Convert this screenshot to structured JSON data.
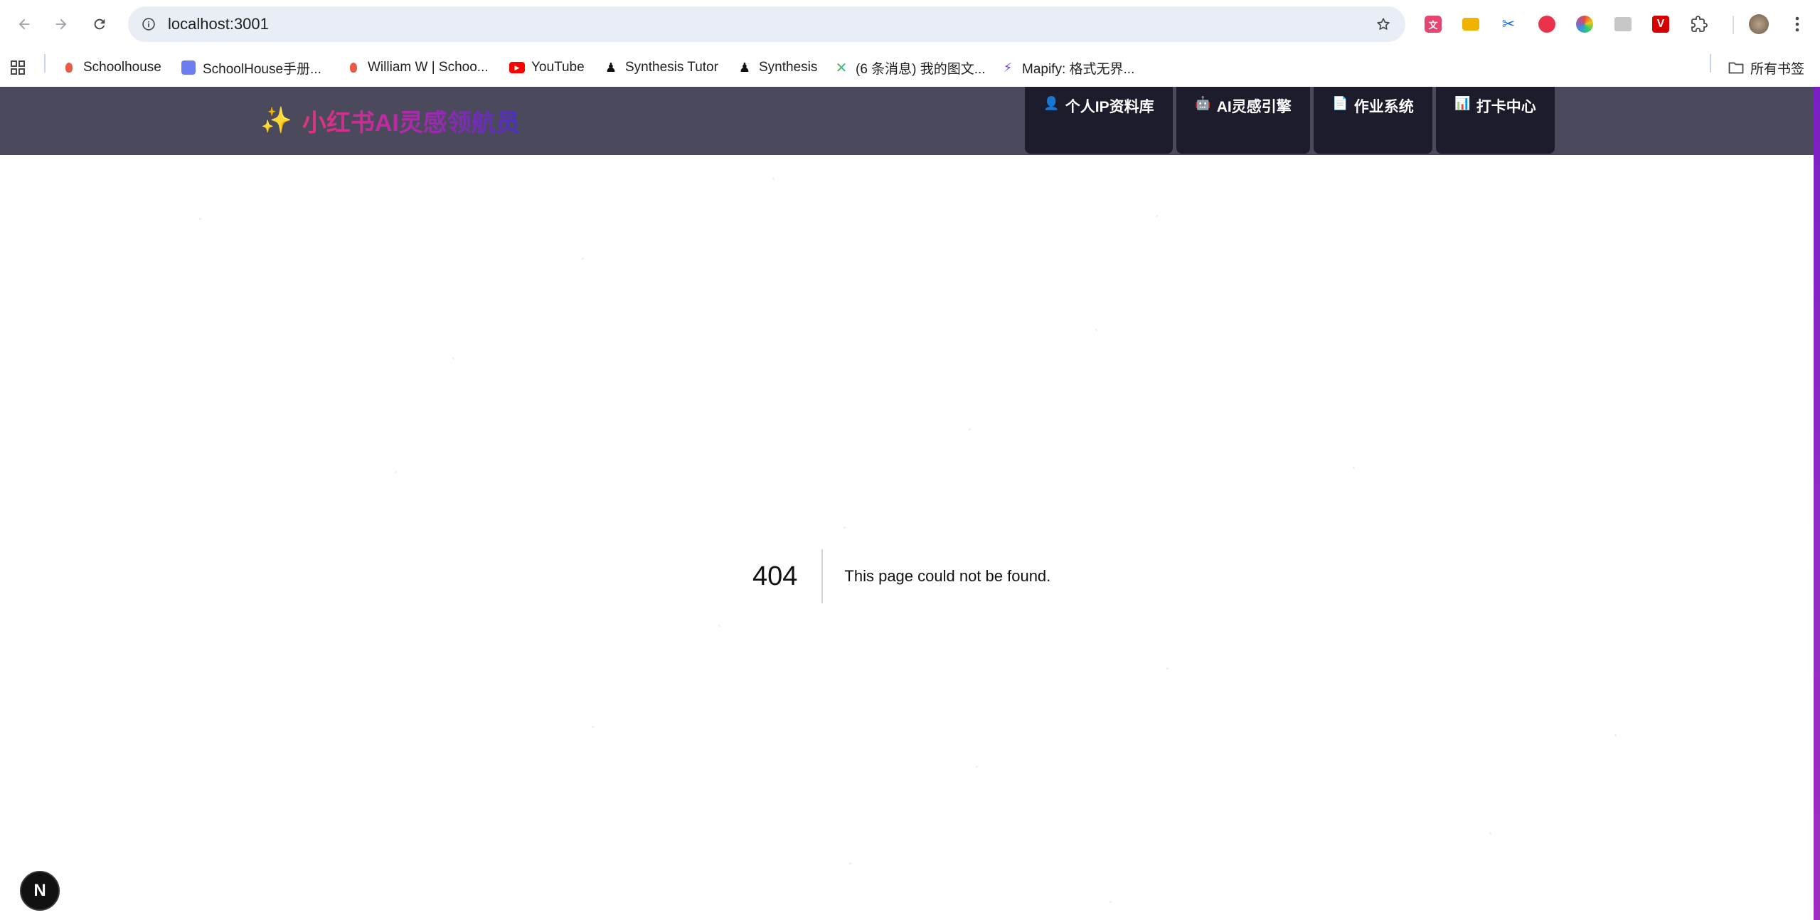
{
  "browser": {
    "url": "localhost:3001",
    "bookmarks": [
      {
        "label": "Schoolhouse",
        "icon": "schoolhouse-icon"
      },
      {
        "label": "SchoolHouse手册...",
        "icon": "schoolhouse-handbook-icon"
      },
      {
        "label": "William W | Schoo...",
        "icon": "schoolhouse-icon"
      },
      {
        "label": "YouTube",
        "icon": "youtube-icon"
      },
      {
        "label": "Synthesis Tutor",
        "icon": "synthesis-icon"
      },
      {
        "label": "Synthesis",
        "icon": "synthesis-icon"
      },
      {
        "label": "(6 条消息) 我的图文...",
        "icon": "colorful-x-icon"
      },
      {
        "label": "Mapify: 格式无界...",
        "icon": "mapify-icon"
      }
    ],
    "all_bookmarks_label": "所有书签"
  },
  "app": {
    "sparkle": "✨",
    "title": "小红书AI灵感领航员",
    "nav": [
      {
        "icon": "👤",
        "label": "个人IP资料库"
      },
      {
        "icon": "🤖",
        "label": "AI灵感引擎"
      },
      {
        "icon": "📄",
        "label": "作业系统"
      },
      {
        "icon": "📊",
        "label": "打卡中心"
      }
    ]
  },
  "error": {
    "code": "404",
    "message": "This page could not be found."
  },
  "dev_badge": "N",
  "colors": {
    "header_bg": "#4a4a5c",
    "nav_tab_bg": "#1c1c2c",
    "brand_gradient_start": "#e0357a",
    "brand_gradient_end": "#4a2fc0",
    "side_stripe": "#8e2ac8"
  }
}
